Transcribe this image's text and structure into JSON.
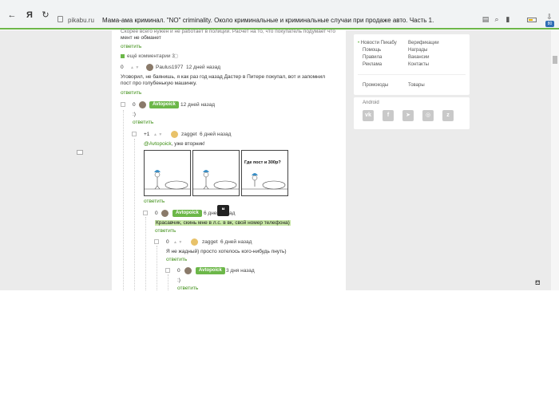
{
  "browser": {
    "back_glyph": "←",
    "yandex_glyph": "Я",
    "reload_glyph": "↻",
    "host": "pikabu.ru",
    "title": "Мама-ама криминал. \"NO\" criminality. Около криминальные и криминальные случаи при продаже авто. Часть 1.",
    "icons": [
      "back-icon",
      "yandex-logo-icon",
      "reload-icon",
      "lock-icon",
      "reader-icon",
      "search-icon",
      "bookmark-icon",
      "battery-icon"
    ],
    "ext_badge": "80"
  },
  "comments": {
    "top_partial_1": "Скорее всего нужен и не работает в полиции. Расчет на то, что покупатель подумает что",
    "top_partial_2": "мент не обманет",
    "reply_1": "ответить",
    "more_comments": "ещё комментарии 3",
    "c1": {
      "score": "0",
      "user": "Paulus1977",
      "time": "12 дней назад",
      "text_1": "Уговорил, не баянишь, я как раз год назад Дастер в Питере покупал, вот и запомнил",
      "text_2": "пост про голубенькую машинку.",
      "reply": "ответить"
    },
    "c2": {
      "score": "0",
      "user": "Avtopoick",
      "time": "12 дней назад",
      "text": ":)",
      "reply": "ответить"
    },
    "c3": {
      "score": "+1",
      "user": "zagget",
      "time": "6 дней назад",
      "mention": "@Avtopoick",
      "text": ", уже вторник!",
      "comic_speech": "Где пост и 300р?",
      "reply": "ответить"
    },
    "c4": {
      "score": "0",
      "user": "Avtopoick",
      "time": "6 дней назад",
      "text": "Красавчик, скинь мне в л.с. в вк, свой номер телефона)",
      "reply": "ответить"
    },
    "c5": {
      "score": "0",
      "user": "zagget",
      "time": "6 дней назад",
      "text": "Я не жадный) просто хотелось кого-нибудь пнуть)",
      "reply": "ответить"
    },
    "c6": {
      "score": "0",
      "user": "Avtopoick",
      "time": "3 дня назад",
      "text": ":)",
      "reply": "ответить"
    },
    "quote_tooltip": "❝"
  },
  "sidebar": {
    "links_col1": [
      "Новости Пикабу",
      "Помощь",
      "Правила",
      "Реклама"
    ],
    "links_col2": [
      "Верификации",
      "Награды",
      "Вакансии",
      "Контакты"
    ],
    "promo": "Промокоды",
    "goods": "Товары",
    "android": "Android",
    "social": [
      "vk-icon",
      "facebook-icon",
      "telegram-icon",
      "instagram-icon",
      "zen-icon"
    ]
  }
}
